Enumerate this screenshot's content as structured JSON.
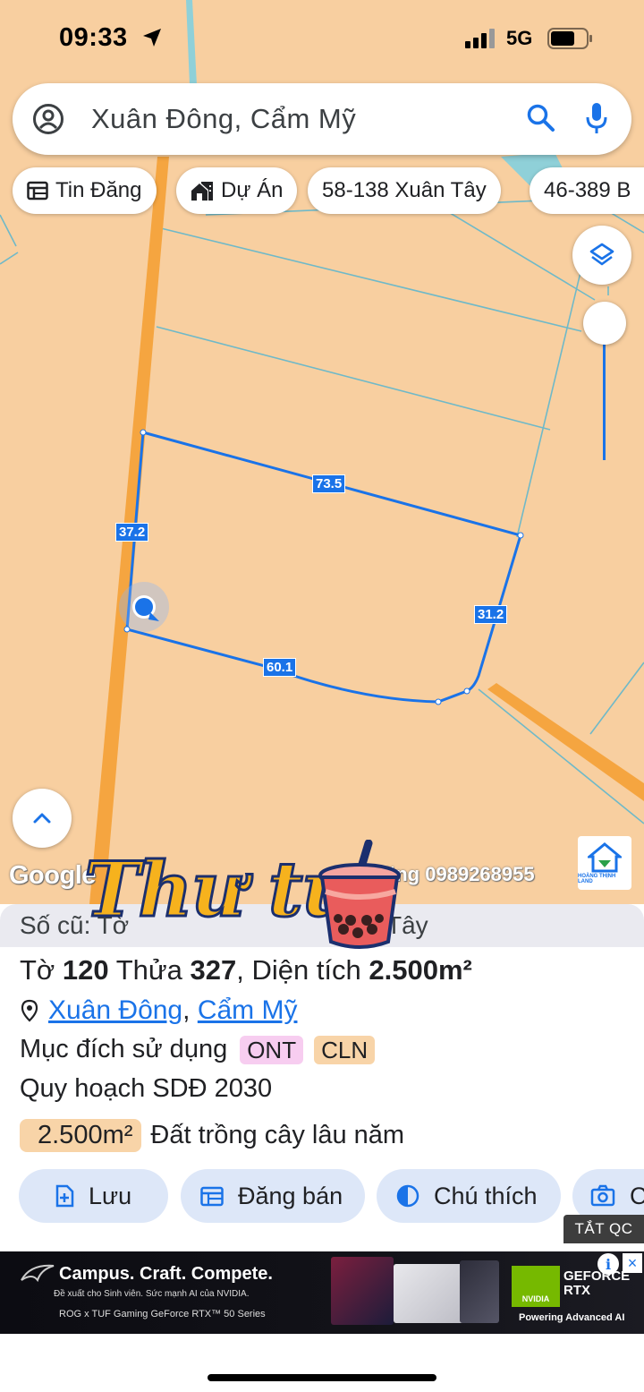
{
  "status_bar": {
    "time": "09:33",
    "network": "5G"
  },
  "search": {
    "query": "Xuân Đông, Cẩm Mỹ",
    "account_icon": "account-circle-icon",
    "search_icon": "search-icon",
    "mic_icon": "mic-icon"
  },
  "chips": [
    {
      "label": "Tin Đăng",
      "icon": "listing-icon"
    },
    {
      "label": "Dự Án",
      "icon": "project-icon"
    },
    {
      "label": "58-138 Xuân Tây"
    },
    {
      "label": "46-389 B"
    }
  ],
  "map": {
    "dimension_labels": [
      "73.5",
      "37.2",
      "31.2",
      "60.1"
    ],
    "google_logo": "Google",
    "watermark_phone_prefix": "ăng",
    "watermark_phone": "0989268955",
    "brand_logo_text": "HOÀNG THỊNH LAND",
    "sticker_text": "Thư tư",
    "colors": {
      "land": "#f8cfa0",
      "road": "#f5a540",
      "parcel_line": "#1a73e8",
      "grid_line": "#6fb9c8"
    }
  },
  "info": {
    "old_prefix": "Số cũ: Tờ",
    "old_suffix": "Tây",
    "parcel": {
      "sheet_label": "Tờ",
      "sheet": "120",
      "lot_label": "Thửa",
      "lot": "327",
      "area_label": ", Diện tích",
      "area": "2.500m²"
    },
    "location": {
      "commune": "Xuân Đông",
      "separator": ",",
      "district": "Cẩm Mỹ"
    },
    "purpose_label": "Mục đích sử dụng",
    "purpose_tags": [
      "ONT",
      "CLN"
    ],
    "plan_label": "Quy hoạch SDĐ 2030",
    "area_badge": "2.500m²",
    "area_use": "Đất trồng cây lâu năm",
    "actions": [
      {
        "label": "Lưu",
        "icon": "save-doc-icon"
      },
      {
        "label": "Đăng bán",
        "icon": "calendar-icon"
      },
      {
        "label": "Chú thích",
        "icon": "contrast-icon"
      },
      {
        "label": "C",
        "icon": "camera-icon"
      }
    ]
  },
  "ad": {
    "close_label": "TẮT QC",
    "headline": "Campus. Craft. Compete.",
    "subline": "Đề xuất cho Sinh viên. Sức mạnh AI của NVIDIA.",
    "series": "ROG x TUF Gaming GeForce RTX™ 50 Series",
    "nvidia": "NVIDIA",
    "geforce": "GEFORCE RTX",
    "powering": "Powering Advanced AI",
    "info_glyph": "i",
    "close_glyph": "×"
  }
}
